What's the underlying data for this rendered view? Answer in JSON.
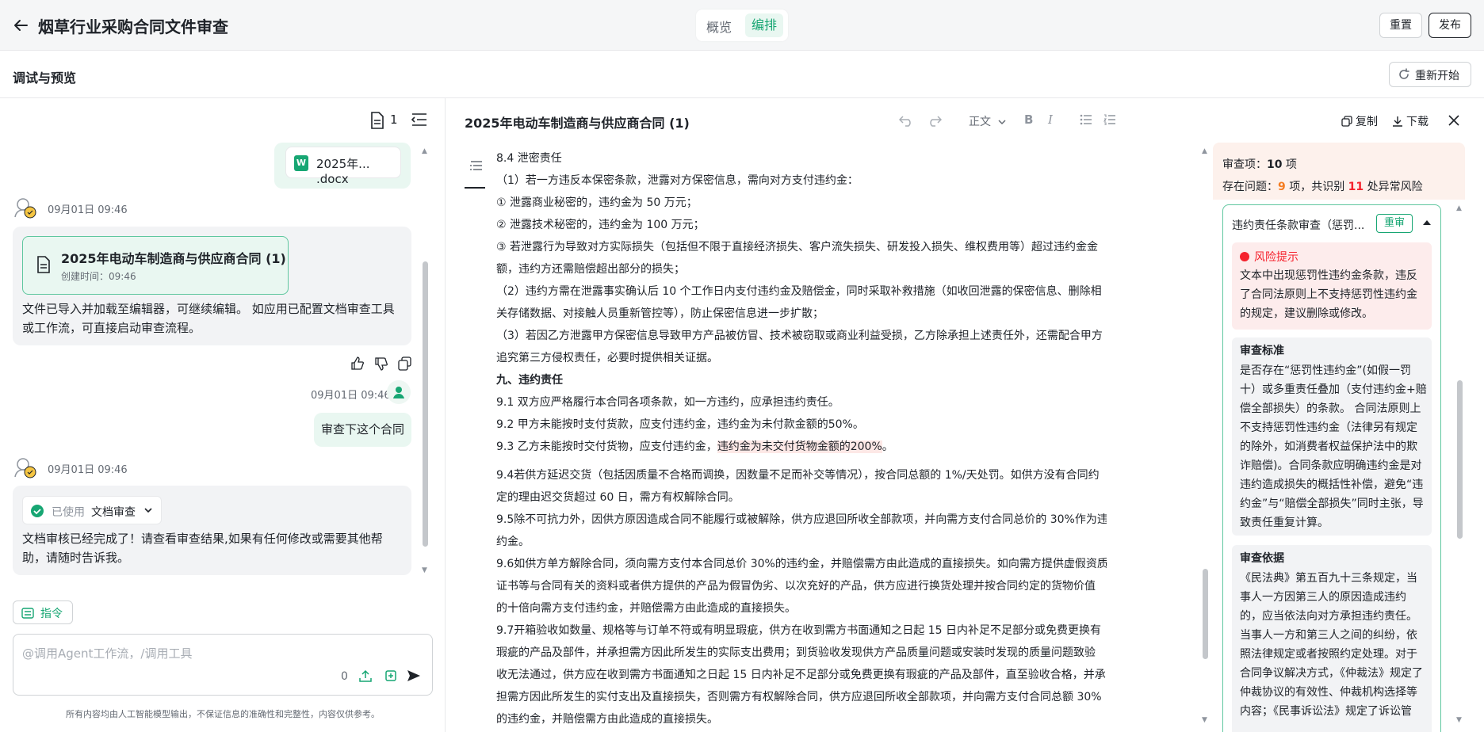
{
  "header": {
    "title": "烟草行业采购合同文件审查",
    "tabs": [
      "概览",
      "编排"
    ],
    "active_tab": "编排",
    "reset_label": "重置",
    "publish_label": "发布"
  },
  "subheader": {
    "title": "调试与预览",
    "restart_label": "重新开始"
  },
  "chat": {
    "doc_count": "1",
    "file_chip": "2025年... .docx",
    "messages": [
      {
        "time": "09月01日 09:46"
      },
      {
        "time": "09月01日 09:46"
      },
      {
        "time": "09月01日 09:46"
      }
    ],
    "doc_card": {
      "title": "2025年电动车制造商与供应商合同 (1)",
      "created": "创建时间：09:46"
    },
    "bot_text_1": "文件已导入并加载至编辑器，可继续编辑。 如应用已配置文档审查工具或工作流，可直接启动审查流程。",
    "user_text": "审查下这个合同",
    "tool_used_label": "已使用",
    "tool_name": "文档审查",
    "bot_text_2": "文档审核已经完成了！请查看审查结果,如果有任何修改或需要其他帮助，请随时告诉我。",
    "command_label": "指令",
    "input_placeholder": "@调用Agent工作流，/调用工具",
    "input_count": "0",
    "disclaimer": "所有内容均由人工智能模型输出，不保证信息的准确性和完整性，内容仅供参考。"
  },
  "editor": {
    "title": "2025年电动车制造商与供应商合同 (1)",
    "style_select": "正文",
    "bold": "B",
    "italic": "I",
    "copy_label": "复制",
    "download_label": "下载",
    "lines": [
      {
        "text": "8.4 泄密责任"
      },
      {
        "text": "（1）若一方违反本保密条款，泄露对方保密信息，需向对方支付违约金："
      },
      {
        "text": "① 泄露商业秘密的，违约金为 50 万元；"
      },
      {
        "text": "② 泄露技术秘密的，违约金为 100 万元；"
      },
      {
        "text": "③ 若泄露行为导致对方实际损失（包括但不限于直接经济损失、客户流失损失、研发投入损失、维权费用等）超过违约金金"
      },
      {
        "text": "额，违约方还需赔偿超出部分的损失；"
      },
      {
        "text": "（2）违约方需在泄露事实确认后 10 个工作日内支付违约金及赔偿金，同时采取补救措施（如收回泄露的保密信息、删除相"
      },
      {
        "text": "关存储数据、对接触人员重新管控等），防止保密信息进一步扩散；"
      },
      {
        "text": "（3）若因乙方泄露甲方保密信息导致甲方产品被仿冒、技术被窃取或商业利益受损，乙方除承担上述责任外，还需配合甲方"
      },
      {
        "text": "追究第三方侵权责任，必要时提供相关证据。"
      },
      {
        "text": "九、违约责任",
        "heading": true
      },
      {
        "text": "9.1 双方应严格履行本合同各项条款，如一方违约，应承担违约责任。"
      },
      {
        "text": "9.2 甲方未能按时支付货款，应支付违约金，违约金为未付款金额的50%。"
      },
      {
        "pre": "9.3 乙方未能按时交付货物，应支付违约金，",
        "highlight": "违约金为未交付货物金额的200%",
        "post": "。"
      },
      {
        "text": "9.4若供方延迟交货（包括因质量不合格而调换，因数量不足而补交等情况），按合同总额的 1%/天处罚。如供方没有合同约",
        "gap": true
      },
      {
        "text": "定的理由迟交货超过 60 日，需方有权解除合同。"
      },
      {
        "text": "9.5除不可抗力外，因供方原因造成合同不能履行或被解除，供方应退回所收全部款项，并向需方支付合同总价的 30%作为违"
      },
      {
        "text": "约金。"
      },
      {
        "text": "9.6如供方单方解除合同，须向需方支付本合同总价 30%的违约金，并赔偿需方由此造成的直接损失。如向需方提供虚假资质"
      },
      {
        "text": "证书等与合同有关的资料或者供方提供的产品为假冒伪劣、以次充好的产品，供方应进行换货处理并按合同约定的货物价值"
      },
      {
        "text": "的十倍向需方支付违约金，并赔偿需方由此造成的直接损失。"
      },
      {
        "text": "9.7开箱验收如数量、规格等与订单不符或有明显瑕疵，供方在收到需方书面通知之日起 15 日内补足不足部分或免费更换有"
      },
      {
        "text": "瑕疵的产品及部件，并承担需方因此所发生的实际支出费用；到货验收发现供方产品质量问题或安装时发现的质量问题致验"
      },
      {
        "text": "收无法通过，供方应在收到需方书面通知之日起 15 日内补足不足部分或免费更换有瑕疵的产品及部件，直至验收合格，并承"
      },
      {
        "text": "担需方因此所发生的实付支出及直接损失，否则需方有权解除合同，供方应退回所收全部款项，并向需方支付合同总额 30%"
      },
      {
        "text": "的违约金，并赔偿需方由此造成的直接损失。"
      }
    ]
  },
  "review": {
    "items_label": "审查项：",
    "items_count": "10",
    "items_unit": " 项",
    "issues_label": "存在问题：",
    "issues_count": "9",
    "issues_mid": " 项，共识别 ",
    "risk_count": "11",
    "risk_unit": " 处异常风险",
    "card_title": "违约责任条款审查（惩罚...",
    "card_tag": "重审",
    "risk_title": "风险提示",
    "risk_text": "文本中出现惩罚性违约金条款，违反了合同法原则上不支持惩罚性违约金的规定，建议删除或修改。",
    "standard_title": "审查标准",
    "standard_text": "是否存在“惩罚性违约金”(如假一罚十）或多重责任叠加（支付违约金+赔偿全部损失）的条款。 合同法原则上不支持惩罚性违约金（法律另有规定的除外，如消费者权益保护法中的欺诈赔偿)。合同条款应明确违约金是对违约造成损失的概括性补偿，避免“违约金”与“赔偿全部损失”同时主张，导致责任重复计算。",
    "basis_title": "审查依据",
    "basis_text": "《民法典》第五百九十三条规定，当事人一方因第三人的原因造成违约的，应当依法向对方承担违约责任。当事人一方和第三人之间的纠纷，依照法律规定或者按照约定处理。对于合同争议解决方式，《仲裁法》规定了仲裁协议的有效性、仲裁机构选择等内容；《民事诉讼法》规定了诉讼管辖、诉讼程序等内容。"
  },
  "colors": {
    "accent": "#17a673",
    "danger": "#f5222d",
    "warning": "#f57d22",
    "highlight": "#fde8e6"
  }
}
